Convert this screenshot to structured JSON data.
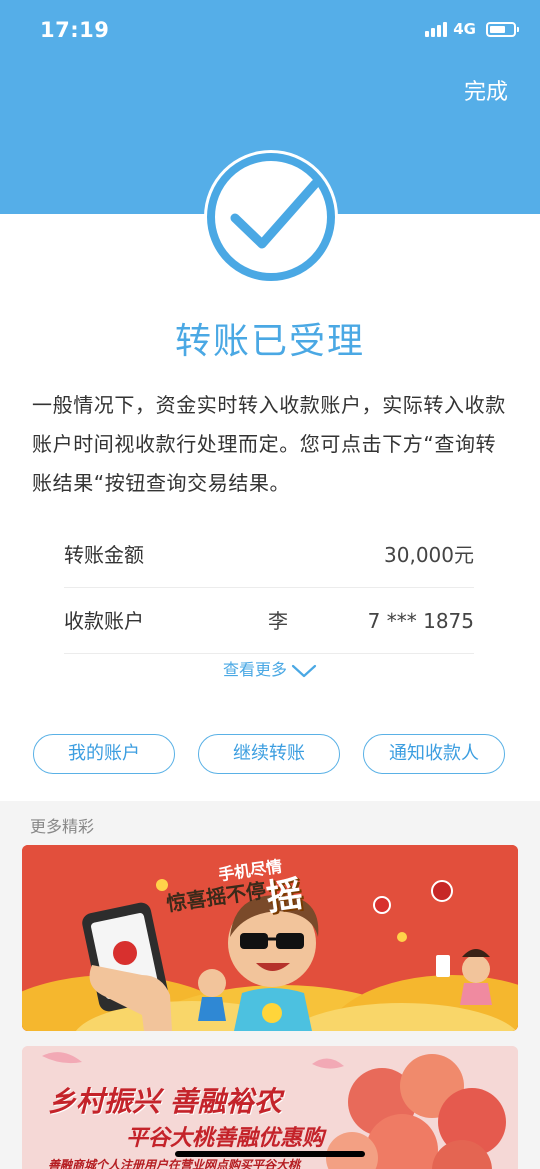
{
  "status_bar": {
    "time": "17:19",
    "network": "4G"
  },
  "header": {
    "done_label": "完成"
  },
  "result": {
    "title": "转账已受理",
    "description": "一般情况下，资金实时转入收款账户，实际转入收款账户时间视收款行处理而定。您可点击下方“查询转账结果“按钮查询交易结果。"
  },
  "details": {
    "amount_label": "转账金额",
    "amount_value": "30,000元",
    "account_label": "收款账户",
    "account_name": "李",
    "account_number": "7 *** 1875"
  },
  "view_more_label": "查看更多",
  "actions": {
    "my_account": "我的账户",
    "continue_transfer": "继续转账",
    "notify_payee": "通知收款人"
  },
  "more": {
    "title": "更多精彩",
    "banner1": {
      "line1": "手机尽情",
      "line2": "惊喜摇不停",
      "big": "摇"
    },
    "banner2": {
      "line1": "乡村振兴 善融裕农",
      "line2": "平谷大桃善融优惠购",
      "line3": "善融商城个人注册用户在营业网点购买平谷大桃"
    }
  },
  "colors": {
    "brand_blue": "#55aee8",
    "title_blue": "#4aa8e4",
    "banner1_bg": "#e24f3c",
    "banner2_bg": "#f5d8d6"
  },
  "icons": [
    "signal-icon",
    "battery-icon",
    "checkmark-icon",
    "chevron-down-icon"
  ]
}
